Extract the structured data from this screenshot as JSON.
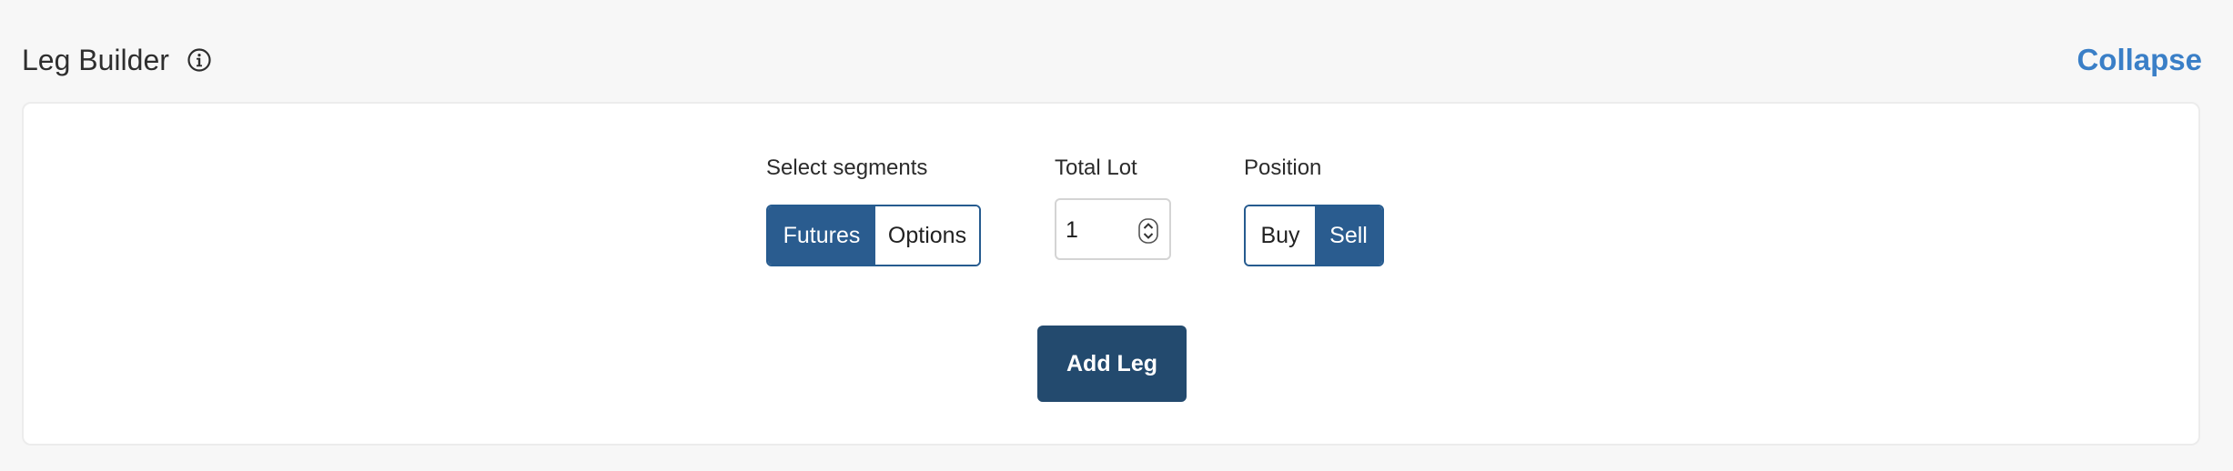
{
  "header": {
    "title": "Leg Builder",
    "info_icon": "info-circle-icon",
    "collapse_label": "Collapse"
  },
  "segments": {
    "label": "Select segments",
    "options": [
      "Futures",
      "Options"
    ],
    "selected": "Futures"
  },
  "total_lot": {
    "label": "Total Lot",
    "value": "1",
    "spinner_icon": "number-spinner-icon"
  },
  "position": {
    "label": "Position",
    "options": [
      "Buy",
      "Sell"
    ],
    "selected": "Sell"
  },
  "add_leg_label": "Add Leg",
  "colors": {
    "accent": "#2a5c8f",
    "primary_button": "#234a6e",
    "link": "#3a7fc7",
    "page_background": "#f7f7f7"
  }
}
